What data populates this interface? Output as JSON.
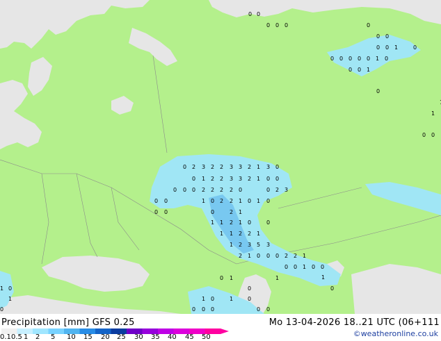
{
  "footer": {
    "title": "Precipitation [mm]  GFS 0.25",
    "datetime": "Mo 13-04-2026 18..21 UTC (06+111",
    "credit": "©weatheronline.co.uk"
  },
  "legend": {
    "labels": [
      "0.1",
      "0.5",
      "1",
      "2",
      "5",
      "10",
      "15",
      "20",
      "25",
      "30",
      "35",
      "40",
      "45",
      "50"
    ],
    "colors": [
      "#f0f0f0",
      "#c8f0ff",
      "#a0e6ff",
      "#78d2ff",
      "#50b4f0",
      "#288ce6",
      "#1464c8",
      "#0a3ca0",
      "#6e00c8",
      "#9600dc",
      "#be00e6",
      "#dc00dc",
      "#f000c8",
      "#ff00a0"
    ]
  },
  "colors": {
    "land": "#b4f08c",
    "sea": "#e6e6e6",
    "precip_light": "#a0e6f5",
    "precip_moderate": "#78c8f0"
  },
  "map_labels": [
    "0",
    "0",
    "0",
    "0",
    "0",
    "0",
    "0",
    "0",
    "0",
    "0",
    "1",
    "0",
    "0",
    "0",
    "0",
    "0",
    "0",
    "1",
    "0",
    "0",
    "0",
    "1",
    "0",
    "1",
    "1",
    "0",
    "0",
    "0",
    "2",
    "3",
    "2",
    "2",
    "3",
    "3",
    "2",
    "1",
    "3",
    "0",
    "0",
    "1",
    "2",
    "2",
    "3",
    "3",
    "2",
    "1",
    "0",
    "0",
    "0",
    "0",
    "0",
    "2",
    "2",
    "2",
    "2",
    "0",
    "0",
    "2",
    "3",
    "0",
    "0",
    "1",
    "0",
    "2",
    "2",
    "1",
    "0",
    "1",
    "0",
    "0",
    "0",
    "0",
    "2",
    "1",
    "0",
    "1",
    "1",
    "2",
    "1",
    "0",
    "1",
    "1",
    "2",
    "2",
    "1",
    "1",
    "2",
    "3",
    "5",
    "3",
    "2",
    "1",
    "0",
    "0",
    "0",
    "2",
    "2",
    "1",
    "0",
    "0",
    "1",
    "0",
    "0",
    "1",
    "0",
    "1",
    "0",
    "1",
    "0",
    "1",
    "0",
    "1",
    "0",
    "0",
    "0",
    "0",
    "0",
    "0",
    "1",
    "0",
    "1",
    "0"
  ]
}
